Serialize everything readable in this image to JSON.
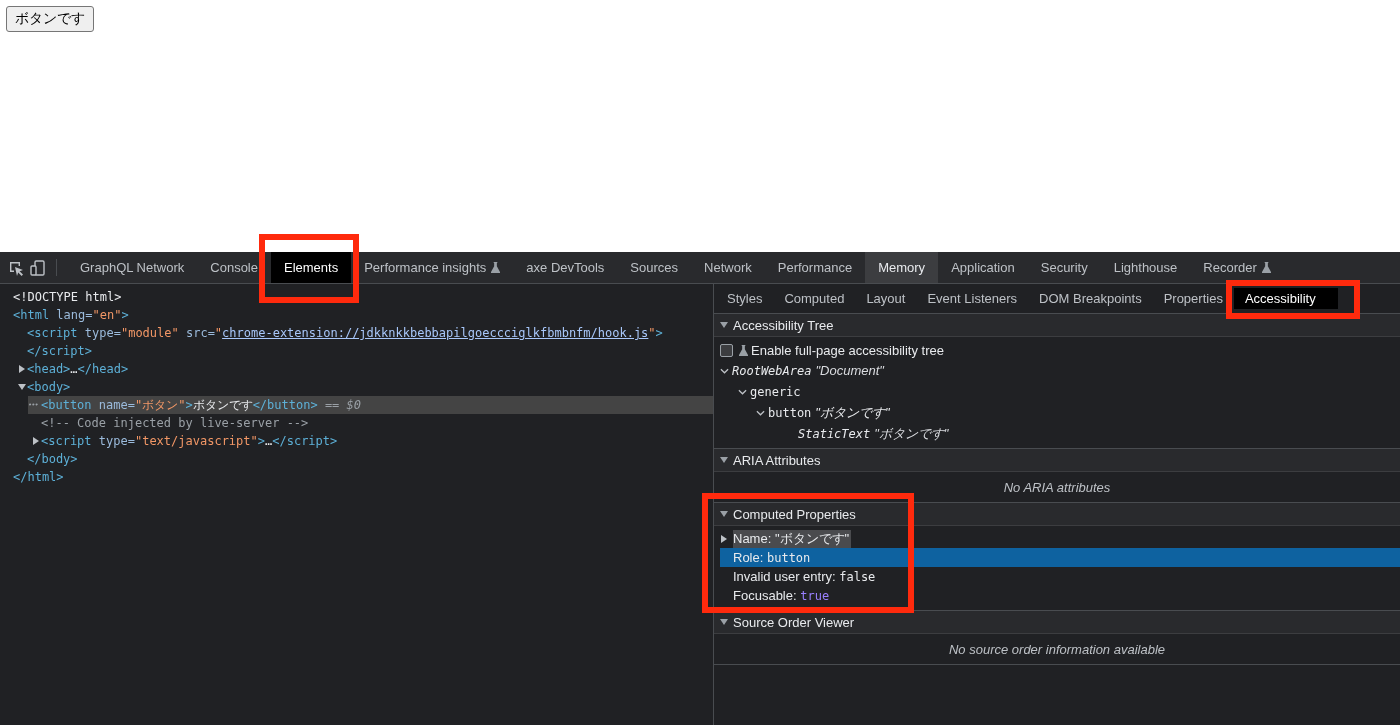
{
  "page": {
    "button": "ボタンです"
  },
  "devtools": {
    "tabs": [
      {
        "label": "GraphQL Network",
        "selected": false,
        "highlighted": false,
        "flask": false
      },
      {
        "label": "Console",
        "selected": false,
        "highlighted": false,
        "flask": false
      },
      {
        "label": "Elements",
        "selected": false,
        "highlighted": true,
        "flask": false
      },
      {
        "label": "Performance insights",
        "selected": false,
        "highlighted": false,
        "flask": true
      },
      {
        "label": "axe DevTools",
        "selected": false,
        "highlighted": false,
        "flask": false
      },
      {
        "label": "Sources",
        "selected": false,
        "highlighted": false,
        "flask": false
      },
      {
        "label": "Network",
        "selected": false,
        "highlighted": false,
        "flask": false
      },
      {
        "label": "Performance",
        "selected": false,
        "highlighted": false,
        "flask": false
      },
      {
        "label": "Memory",
        "selected": true,
        "highlighted": false,
        "flask": false
      },
      {
        "label": "Application",
        "selected": false,
        "highlighted": false,
        "flask": false
      },
      {
        "label": "Security",
        "selected": false,
        "highlighted": false,
        "flask": false
      },
      {
        "label": "Lighthouse",
        "selected": false,
        "highlighted": false,
        "flask": false
      },
      {
        "label": "Recorder",
        "selected": false,
        "highlighted": false,
        "flask": true
      }
    ],
    "dom_tree": [
      {
        "parts": [
          {
            "kind": "plain",
            "text": "<!DOCTYPE html>"
          }
        ]
      },
      {
        "parts": [
          {
            "kind": "tag",
            "text": "<html"
          },
          {
            "kind": "attr",
            "text": " lang="
          },
          {
            "kind": "value",
            "text": "\"en\""
          },
          {
            "kind": "tag",
            "text": ">"
          }
        ],
        "children": [
          {
            "parts": [
              {
                "kind": "tag",
                "text": "<script"
              },
              {
                "kind": "attr",
                "text": " type="
              },
              {
                "kind": "value",
                "text": "\"module\""
              },
              {
                "kind": "attr",
                "text": " src="
              },
              {
                "kind": "value",
                "text": "\""
              },
              {
                "kind": "link",
                "text": "chrome-extension://jdkknkkbebbapilgoeccciglkfbmbnfm/hook.js"
              },
              {
                "kind": "value",
                "text": "\""
              },
              {
                "kind": "tag",
                "text": ">"
              }
            ]
          },
          {
            "parts": [
              {
                "kind": "tag",
                "text": "</script>"
              }
            ]
          },
          {
            "expanded": false,
            "parts": [
              {
                "kind": "tag",
                "text": "<head>"
              },
              {
                "kind": "plain",
                "text": "…"
              },
              {
                "kind": "tag",
                "text": "</head>"
              }
            ]
          },
          {
            "expanded": true,
            "parts": [
              {
                "kind": "tag",
                "text": "<body>"
              }
            ],
            "children": [
              {
                "selected": true,
                "gutter": "•••",
                "parts": [
                  {
                    "kind": "tag",
                    "text": "<button"
                  },
                  {
                    "kind": "attr",
                    "text": " name="
                  },
                  {
                    "kind": "value",
                    "text": "\"ボタン\""
                  },
                  {
                    "kind": "tag",
                    "text": ">"
                  },
                  {
                    "kind": "plain",
                    "text": "ボタンです"
                  },
                  {
                    "kind": "tag",
                    "text": "</button>"
                  },
                  {
                    "kind": "marker",
                    "text": " == $0"
                  }
                ]
              },
              {
                "parts": [
                  {
                    "kind": "comment",
                    "text": "<!-- Code injected by live-server -->"
                  }
                ]
              },
              {
                "expanded": false,
                "parts": [
                  {
                    "kind": "tag",
                    "text": "<script"
                  },
                  {
                    "kind": "attr",
                    "text": " type="
                  },
                  {
                    "kind": "value",
                    "text": "\"text/javascript\""
                  },
                  {
                    "kind": "tag",
                    "text": ">"
                  },
                  {
                    "kind": "plain",
                    "text": "…"
                  },
                  {
                    "kind": "tag",
                    "text": "</script>"
                  }
                ]
              }
            ]
          },
          {
            "parts": [
              {
                "kind": "tag",
                "text": "</body>"
              }
            ]
          }
        ]
      },
      {
        "parts": [
          {
            "kind": "tag",
            "text": "</html>"
          }
        ]
      }
    ],
    "subtabs": [
      {
        "label": "Styles",
        "selected": false,
        "highlighted": false
      },
      {
        "label": "Computed",
        "selected": false,
        "highlighted": false
      },
      {
        "label": "Layout",
        "selected": false,
        "highlighted": false
      },
      {
        "label": "Event Listeners",
        "selected": false,
        "highlighted": false
      },
      {
        "label": "DOM Breakpoints",
        "selected": false,
        "highlighted": false
      },
      {
        "label": "Properties",
        "selected": false,
        "highlighted": false
      },
      {
        "label": "Accessibility",
        "selected": true,
        "highlighted": true
      }
    ],
    "accessibility_tree": {
      "title": "Accessibility Tree",
      "expanded": true,
      "option": {
        "label": "Enable full-page accessibility tree",
        "checked": false
      },
      "nodes": [
        {
          "kind": "root",
          "role": "RootWebArea",
          "name": "\"Document\"",
          "expanded": true,
          "children": [
            {
              "kind": "node",
              "role": "generic",
              "expanded": true,
              "children": [
                {
                  "kind": "node",
                  "role": "button",
                  "name": "\"ボタンです\"",
                  "expanded": true,
                  "children": [
                    {
                      "kind": "text",
                      "role": "StaticText",
                      "name": "\"ボタンです\""
                    }
                  ]
                }
              ]
            }
          ]
        }
      ]
    },
    "aria_attributes": {
      "title": "ARIA Attributes",
      "expanded": true,
      "empty_text": "No ARIA attributes"
    },
    "computed_properties": {
      "title": "Computed Properties",
      "expanded": true,
      "highlighted": true,
      "rows": [
        {
          "label": "Name:",
          "value": "\"ボタンです\"",
          "kind": "string",
          "expanded": false,
          "selected": false,
          "hovered": true
        },
        {
          "label": "Role:",
          "value": "button",
          "kind": "code",
          "selected": true,
          "hovered": false
        },
        {
          "label": "Invalid user entry:",
          "value": "false",
          "kind": "code",
          "selected": false,
          "hovered": false
        },
        {
          "label": "Focusable:",
          "value": "true",
          "kind": "keyword",
          "selected": false,
          "hovered": false
        }
      ]
    },
    "source_order": {
      "title": "Source Order Viewer",
      "expanded": true,
      "empty_text": "No source order information available"
    }
  }
}
